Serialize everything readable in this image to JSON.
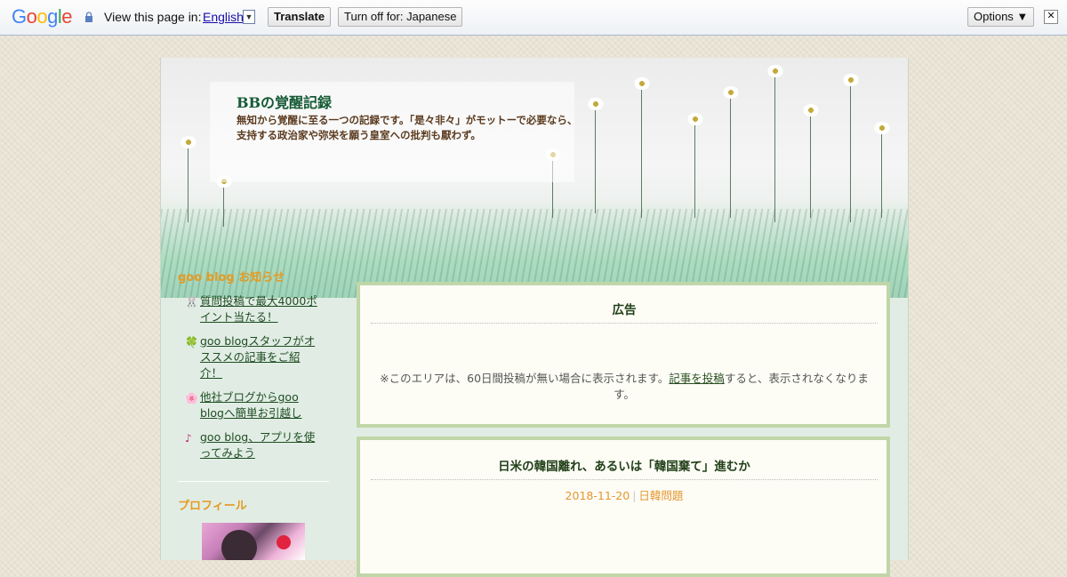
{
  "translate_bar": {
    "logo": "Google",
    "view_text": "View this page in:",
    "language": "English",
    "translate_label": "Translate",
    "turn_off_label": "Turn off for: Japanese",
    "options_label": "Options ▼",
    "close_symbol": "✕"
  },
  "header": {
    "title": "BBの覚醒記録",
    "desc_line1": "無知から覚醒に至る一つの記録です。「是々非々」がモットーで必要なら、",
    "desc_line2": "支持する政治家や弥栄を願う皇室への批判も厭わず。"
  },
  "sidebar": {
    "news_heading": "goo blog お知らせ",
    "news_items": [
      {
        "icon": "rabbit-icon",
        "glyph": "🐰",
        "label": "質問投稿で最大4000ポイント当たる！"
      },
      {
        "icon": "clover-icon",
        "glyph": "🍀",
        "label": "goo blogスタッフがオススメの記事をご紹介！"
      },
      {
        "icon": "flower-icon",
        "glyph": "🌸",
        "label": "他社ブログからgoo blogへ簡単お引越し"
      },
      {
        "icon": "music-note-icon",
        "glyph": "♪",
        "label": "goo blog、アプリを使ってみよう"
      }
    ],
    "profile_heading": "プロフィール"
  },
  "ad": {
    "title": "広告",
    "text_before": "※このエリアは、60日間投稿が無い場合に表示されます。",
    "link": "記事を投稿",
    "text_after": "すると、表示されなくなります。"
  },
  "post": {
    "title": "日米の韓国離れ、あるいは「韓国棄て」進むか",
    "date": "2018-11-20",
    "separator": "|",
    "category": "日韓問題"
  },
  "colors": {
    "accent_orange": "#e59a22",
    "link_green": "#1f4d23",
    "box_border": "#c0d6a8"
  }
}
